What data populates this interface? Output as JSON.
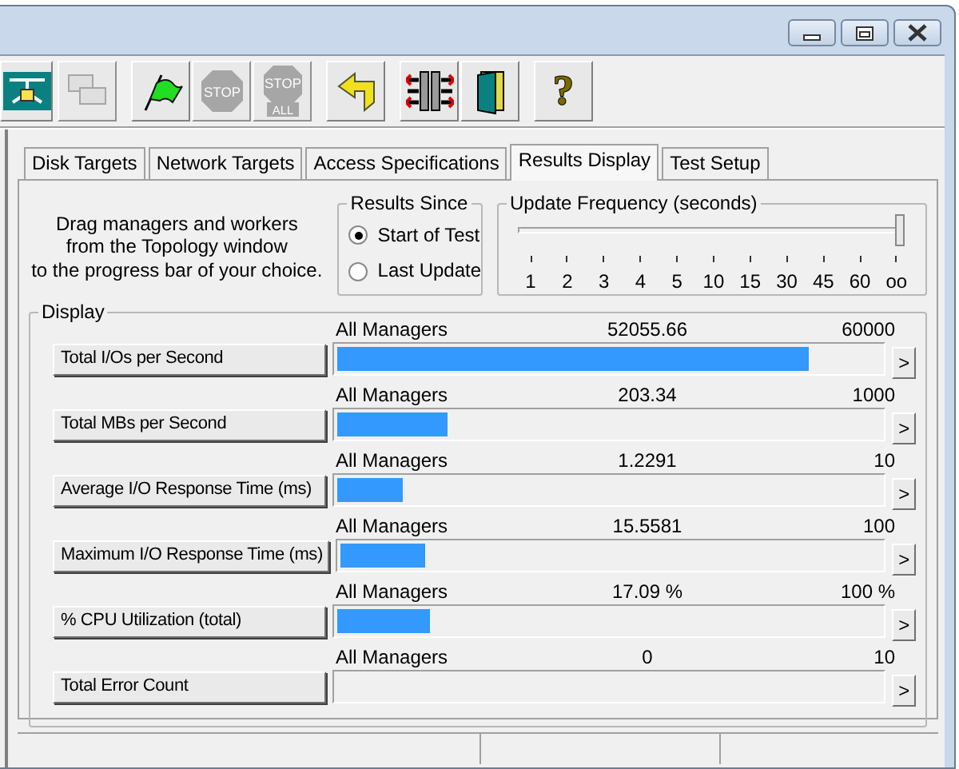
{
  "window": {
    "controls": [
      {
        "kind": "minimize"
      },
      {
        "kind": "maximize"
      },
      {
        "kind": "close"
      }
    ]
  },
  "toolbar": [
    {
      "kind": "topology",
      "disabled": false
    },
    {
      "kind": "workers",
      "disabled": true
    },
    {
      "kind": "start",
      "disabled": false
    },
    {
      "kind": "stop",
      "label": "STOP",
      "disabled": true
    },
    {
      "kind": "stop_all",
      "label": "STOP",
      "sublabel": "ALL",
      "disabled": true
    },
    {
      "kind": "reset",
      "disabled": false
    },
    {
      "kind": "instance",
      "disabled": false
    },
    {
      "kind": "exit",
      "disabled": false
    },
    {
      "kind": "help",
      "label": "?",
      "disabled": false
    }
  ],
  "tabs": [
    {
      "label": "Disk Targets",
      "selected": false
    },
    {
      "label": "Network Targets",
      "selected": false
    },
    {
      "label": "Access Specifications",
      "selected": false
    },
    {
      "label": "Results Display",
      "selected": true
    },
    {
      "label": "Test Setup",
      "selected": false
    }
  ],
  "instructions": "Drag managers and workers\nfrom the Topology window\nto the progress bar of your choice.",
  "results_since": {
    "title": "Results Since",
    "options": [
      {
        "label": "Start of Test",
        "selected": true
      },
      {
        "label": "Last Update",
        "selected": false
      }
    ]
  },
  "update_frequency": {
    "title": "Update Frequency (seconds)",
    "level": 1,
    "ticks": [
      "1",
      "2",
      "3",
      "4",
      "5",
      "10",
      "15",
      "30",
      "45",
      "60",
      "oo"
    ]
  },
  "display": {
    "title": "Display",
    "metrics": [
      {
        "button": "Total I/Os per Second",
        "manager": "All Managers",
        "value": "52055.66",
        "max": "60000",
        "level": 0.868,
        "more": ">"
      },
      {
        "button": "Total MBs per Second",
        "manager": "All Managers",
        "value": "203.34",
        "max": "1000",
        "level": 0.203,
        "more": ">"
      },
      {
        "button": "Average I/O Response Time (ms)",
        "manager": "All Managers",
        "value": "1.2291",
        "max": "10",
        "level": 0.123,
        "more": ">"
      },
      {
        "button": "Maximum I/O Response Time (ms)",
        "manager": "All Managers",
        "value": "15.5581",
        "max": "100",
        "level": 0.156,
        "more": ">"
      },
      {
        "button": "% CPU Utilization (total)",
        "manager": "All Managers",
        "value": "17.09 %",
        "max": "100 %",
        "level": 0.171,
        "more": ">"
      },
      {
        "button": "Total Error Count",
        "manager": "All Managers",
        "value": "0",
        "max": "10",
        "level": 0,
        "more": ">"
      }
    ]
  }
}
